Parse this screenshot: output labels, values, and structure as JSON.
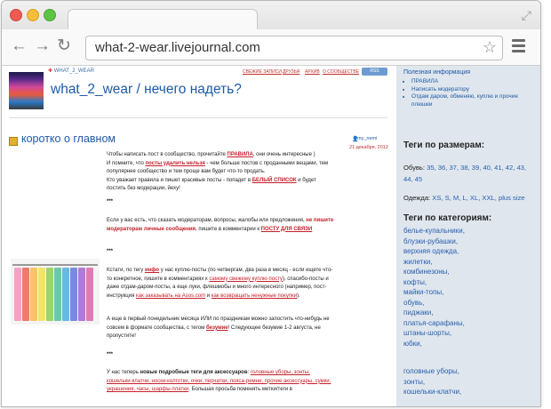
{
  "browser": {
    "url": "what-2-wear.livejournal.com",
    "icons": {
      "back": "back-arrow-icon",
      "forward": "forward-arrow-icon",
      "reload": "reload-icon",
      "bookmark": "star-icon",
      "menu": "hamburger-menu-icon",
      "expand": "expand-icon"
    }
  },
  "journal": {
    "username": "WHAT_2_WEAR",
    "title": "what_2_wear / нечего надеть?",
    "nav": [
      "СВЕЖИЕ ЗАПИСИ",
      "ДРУЗЬЯ",
      "АРХИВ",
      "О СООБЩЕСТВЕ"
    ],
    "rss": "RSS"
  },
  "post": {
    "title": "коротко о главном",
    "author": "my_nemi",
    "date": "21 декабря, 2012",
    "separator": "***",
    "p1": {
      "a": "Чтобы написать пост в сообщество, прочитайте ",
      "link": "ПРАВИЛА",
      "b": ", они очень интересные )",
      "c": "И помните, что ",
      "red": "посты удалить нельзя",
      "d": " - чем больше постов с проданными вещами, тем популярнее сообщество и тем проще вам будет что-то продать.",
      "e": "Кто уважает правила и пишет красивые посты - попадет в ",
      "link2": "БЕЛЫЙ СПИСОК",
      "f": " и будет постить без модерации, йеху!"
    },
    "p2": {
      "a": "Если у вас есть, что сказать модераторам, вопросы, жалобы или предложения, ",
      "red": "не пишите модераторам личные сообщения",
      "b": ", пишите в комментарии к ",
      "link": "ПОСТУ ДЛЯ СВЯЗИ"
    },
    "p3": {
      "a": "Кстати, по тегу ",
      "link": "инфо",
      "b": " у нас куплю-посты (по четвергам, два раза в месяц - если ищете что-то конкретное, пишите в комментариях к ",
      "link2": "самому свежему куплю-посту",
      "c": "), спасибо-посты и даже отдам-даром-посты, а еще луки, флешмобы и много интересного (например, пост-инструкция ",
      "link3": "как заказывать на Asos.com",
      "d": " и ",
      "link4": "как возвращать ненужные покупки",
      "e": ")."
    },
    "p4": {
      "a": "А еще в первый понедельник месяца ИЛИ по праздникам можно запостить что-нибудь не совсем в формате сообщества, с тегом ",
      "link": "безумие",
      "b": "! Следующее безумие 1-2 августа, не пропустите!"
    },
    "p5": {
      "a": "У нас теперь ",
      "bold": "новые подробные теги для аксессуаров",
      "b": ": ",
      "link": "головные уборы, зонты, кошельки-клатчи, носки-колготки, очки, перчатки, пояса-ремни, прочие аксессуары, сумки, украшения, часы, шарфы-платки",
      "c": ". Большая просьба поменять метки/теги в"
    }
  },
  "sidebar": {
    "useful_title": "Полезная информация",
    "useful": [
      "ПРАВИЛА",
      "Написать модератору",
      "Отдам даром, обменяю, куплю и прочие плюшки"
    ],
    "sizes_heading": "Теги по размерам:",
    "shoes_label": "Обувь:",
    "shoes": "35, 36, 37, 38, 39, 40, 41, 42, 43, 44, 45",
    "clothes_label": "Одежда:",
    "clothes": "XS, S, M, L, XL, XXL, plus size",
    "cat_heading": "Теги по категориям:",
    "categories": [
      "белье-купальники,",
      "блузки-рубашки,",
      "верхняя одежда,",
      "жилетки,",
      "комбинезоны,",
      "кофты,",
      "майки-топы,",
      "обувь,",
      "пиджаки,",
      "платья-сарафаны,",
      "штаны-шорты,",
      "юбки,"
    ],
    "categories2": [
      "головные уборы,",
      "зонты,",
      "кошельки-клатчи,"
    ]
  }
}
